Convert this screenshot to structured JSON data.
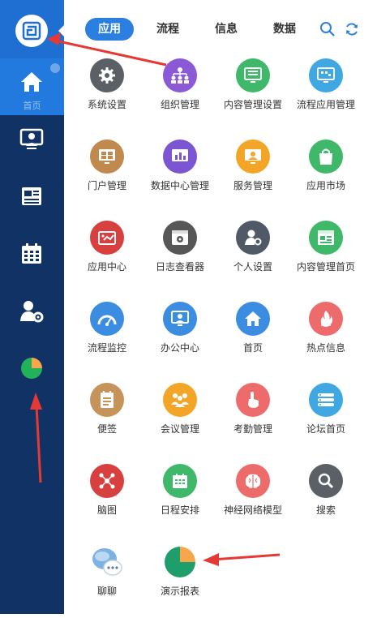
{
  "sidebar": {
    "home_label": "首页"
  },
  "tabs": [
    {
      "label": "应用",
      "active": true
    },
    {
      "label": "流程",
      "active": false
    },
    {
      "label": "信息",
      "active": false
    },
    {
      "label": "数据",
      "active": false
    }
  ],
  "apps": [
    {
      "label": "系统设置",
      "color": "#5b5f66",
      "icon": "gear-icon"
    },
    {
      "label": "组织管理",
      "color": "#8c59d6",
      "icon": "org-chart-icon"
    },
    {
      "label": "内容管理设置",
      "color": "#3fb969",
      "icon": "content-settings-icon"
    },
    {
      "label": "流程应用管理",
      "color": "#3fa8e3",
      "icon": "flow-app-icon"
    },
    {
      "label": "门户管理",
      "color": "#c08a4e",
      "icon": "portal-icon"
    },
    {
      "label": "数据中心管理",
      "color": "#7c55d3",
      "icon": "data-center-icon"
    },
    {
      "label": "服务管理",
      "color": "#f2a526",
      "icon": "service-icon"
    },
    {
      "label": "应用市场",
      "color": "#3fb969",
      "icon": "shopping-bag-icon"
    },
    {
      "label": "应用中心",
      "color": "#d84040",
      "icon": "app-center-icon"
    },
    {
      "label": "日志查看器",
      "color": "#575757",
      "icon": "log-viewer-icon"
    },
    {
      "label": "个人设置",
      "color": "#4f5a66",
      "icon": "user-settings-icon"
    },
    {
      "label": "内容管理首页",
      "color": "#3fb969",
      "icon": "content-home-icon"
    },
    {
      "label": "流程监控",
      "color": "#3a8de0",
      "icon": "gauge-icon"
    },
    {
      "label": "办公中心",
      "color": "#3a8de0",
      "icon": "office-icon"
    },
    {
      "label": "首页",
      "color": "#3a8de0",
      "icon": "house-icon"
    },
    {
      "label": "热点信息",
      "color": "#ee6b6b",
      "icon": "flame-icon"
    },
    {
      "label": "便签",
      "color": "#c6935a",
      "icon": "note-icon"
    },
    {
      "label": "会议管理",
      "color": "#f2a526",
      "icon": "meeting-icon"
    },
    {
      "label": "考勤管理",
      "color": "#ee6b6b",
      "icon": "touch-icon"
    },
    {
      "label": "论坛首页",
      "color": "#3fa8e3",
      "icon": "forum-icon"
    },
    {
      "label": "脑图",
      "color": "#d84040",
      "icon": "mind-map-icon"
    },
    {
      "label": "日程安排",
      "color": "#3fb969",
      "icon": "calendar-icon"
    },
    {
      "label": "神经网络模型",
      "color": "#ee6b6b",
      "icon": "brain-icon"
    },
    {
      "label": "搜索",
      "color": "#5b5f66",
      "icon": "search-icon"
    },
    {
      "label": "聊聊",
      "color": "#9cc3e8",
      "icon": "chat-bubble-icon"
    },
    {
      "label": "演示报表",
      "color": "#1e9e6a",
      "icon": "pie-chart-icon"
    }
  ],
  "colors": {
    "sidebar_bg": "#113264",
    "sidebar_active": "#2279de",
    "tab_active": "#2b7fe0",
    "annotation_arrow": "#e53935"
  }
}
